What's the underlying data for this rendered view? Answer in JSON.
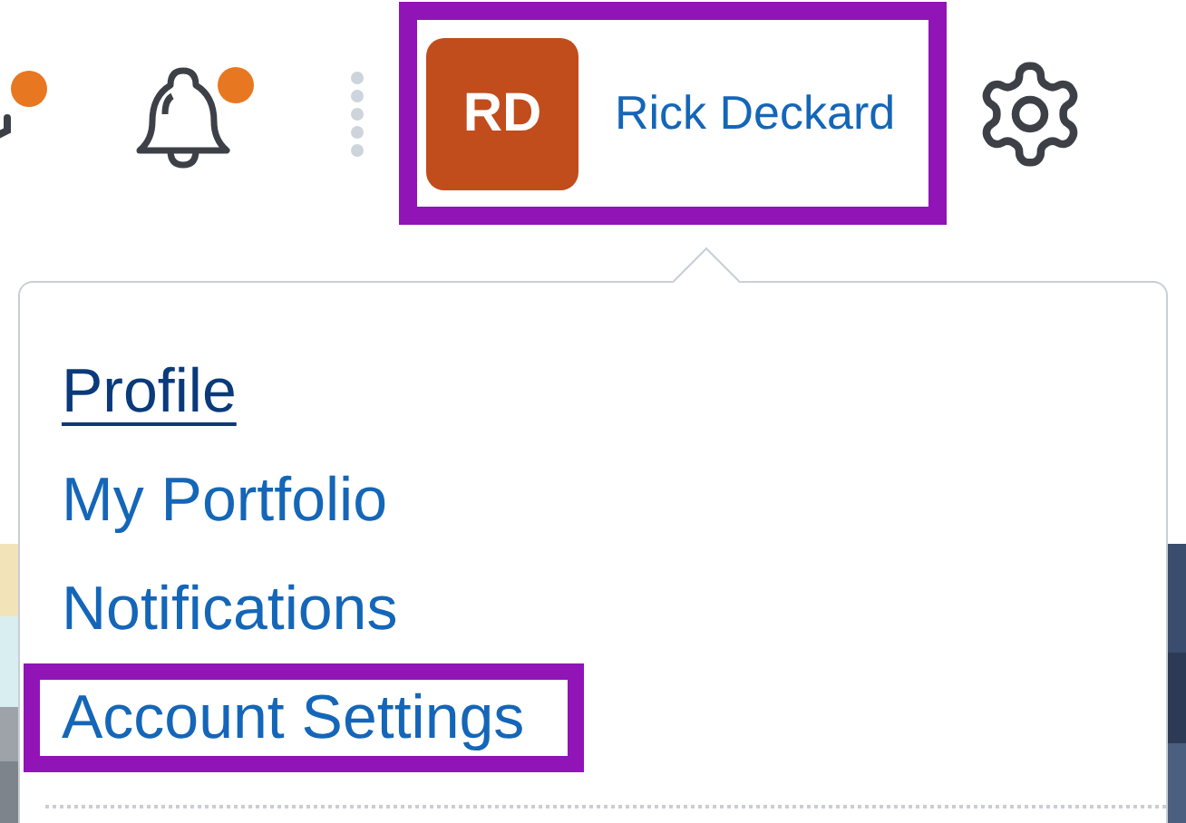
{
  "header": {
    "icons": [
      {
        "kind": "messages",
        "badge": true
      },
      {
        "kind": "bell",
        "badge": true
      }
    ],
    "user": {
      "initials": "RD",
      "name": "Rick Deckard",
      "highlighted": true
    }
  },
  "menu": {
    "items": [
      {
        "label": "Profile",
        "focused": true,
        "highlighted": false
      },
      {
        "label": "My Portfolio",
        "focused": false,
        "highlighted": false
      },
      {
        "label": "Notifications",
        "focused": false,
        "highlighted": false
      },
      {
        "label": "Account Settings",
        "focused": false,
        "highlighted": true
      }
    ]
  }
}
